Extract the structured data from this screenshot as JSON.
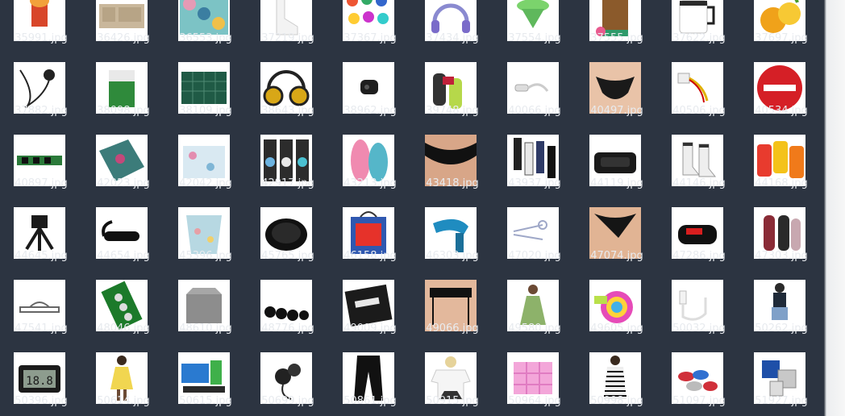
{
  "files": [
    {
      "name": "35991.jpg",
      "icon": "snack-pack-icon"
    },
    {
      "name": "36426.jpg",
      "icon": "fabric-organizer-icon"
    },
    {
      "name": "36553.jpg",
      "icon": "patterned-tins-icon"
    },
    {
      "name": "37219.jpg",
      "icon": "white-socks-icon"
    },
    {
      "name": "37367.jpg",
      "icon": "color-pigments-icon"
    },
    {
      "name": "37434.jpg",
      "icon": "headphones-icon"
    },
    {
      "name": "37554.jpg",
      "icon": "green-funnel-icon"
    },
    {
      "name": "37555.jpg",
      "icon": "bamboo-mat-icon"
    },
    {
      "name": "37622.jpg",
      "icon": "mug-icon"
    },
    {
      "name": "37697.jpg",
      "icon": "citrus-icon"
    },
    {
      "name": "37882.jpg",
      "icon": "lavalier-mic-icon"
    },
    {
      "name": "38098.jpg",
      "icon": "battery-icon"
    },
    {
      "name": "38109.jpg",
      "icon": "cutting-mat-icon"
    },
    {
      "name": "38643.jpg",
      "icon": "gold-headphones-icon"
    },
    {
      "name": "38962.jpg",
      "icon": "earbuds-case-icon"
    },
    {
      "name": "39748.jpg",
      "icon": "fitness-bands-icon"
    },
    {
      "name": "40066.jpg",
      "icon": "adapter-cable-icon"
    },
    {
      "name": "40497.jpg",
      "icon": "lace-panties-icon"
    },
    {
      "name": "40506.jpg",
      "icon": "power-cable-icon"
    },
    {
      "name": "40534.jpg",
      "icon": "no-entry-sign-icon"
    },
    {
      "name": "40897.jpg",
      "icon": "memory-module-icon"
    },
    {
      "name": "42023.jpg",
      "icon": "scarf-icon"
    },
    {
      "name": "42042.jpg",
      "icon": "floral-bag-icon"
    },
    {
      "name": "42917.jpg",
      "icon": "cable-packs-icon"
    },
    {
      "name": "43213.jpg",
      "icon": "flip-flops-icon"
    },
    {
      "name": "43418.jpg",
      "icon": "black-lingerie-icon"
    },
    {
      "name": "43937.jpg",
      "icon": "striped-socks-icon"
    },
    {
      "name": "44119.jpg",
      "icon": "vr-headset-icon"
    },
    {
      "name": "44146.jpg",
      "icon": "ankle-socks-icon"
    },
    {
      "name": "44168.jpg",
      "icon": "phone-cases-icon"
    },
    {
      "name": "44645.jpg",
      "icon": "tripod-icon"
    },
    {
      "name": "44654.jpg",
      "icon": "phone-holder-icon"
    },
    {
      "name": "45396.jpg",
      "icon": "laundry-basket-icon"
    },
    {
      "name": "45765.jpg",
      "icon": "wireless-charger-icon"
    },
    {
      "name": "46158.jpg",
      "icon": "gift-bag-icon"
    },
    {
      "name": "46303.jpg",
      "icon": "guitar-capo-icon"
    },
    {
      "name": "47020.jpg",
      "icon": "hair-pins-icon"
    },
    {
      "name": "47074.jpg",
      "icon": "thong-icon"
    },
    {
      "name": "47286.jpg",
      "icon": "trash-bags-icon"
    },
    {
      "name": "47303.jpg",
      "icon": "power-banks-icon"
    },
    {
      "name": "47541.jpg",
      "icon": "wire-frame-icon"
    },
    {
      "name": "48046.jpg",
      "icon": "coin-batteries-icon"
    },
    {
      "name": "48610.jpg",
      "icon": "storage-box-icon"
    },
    {
      "name": "48776.jpg",
      "icon": "black-beads-icon"
    },
    {
      "name": "49009.jpg",
      "icon": "boxed-product-icon"
    },
    {
      "name": "49066.jpg",
      "icon": "garter-set-icon"
    },
    {
      "name": "49580.jpg",
      "icon": "green-dress-icon"
    },
    {
      "name": "49605.jpg",
      "icon": "colorful-sponges-icon"
    },
    {
      "name": "50032.jpg",
      "icon": "usb-cable-icon"
    },
    {
      "name": "50262.jpg",
      "icon": "denim-outfit-icon"
    },
    {
      "name": "50396.jpg",
      "icon": "digital-thermometer-icon"
    },
    {
      "name": "50614.jpg",
      "icon": "yellow-dress-icon"
    },
    {
      "name": "50615.jpg",
      "icon": "device-set-icon"
    },
    {
      "name": "50699.jpg",
      "icon": "earphones-icon"
    },
    {
      "name": "50861.jpg",
      "icon": "black-trousers-icon"
    },
    {
      "name": "50915.jpg",
      "icon": "white-tshirt-icon"
    },
    {
      "name": "50964.jpg",
      "icon": "pink-organizer-icon"
    },
    {
      "name": "50998.jpg",
      "icon": "striped-dress-icon"
    },
    {
      "name": "51097.jpg",
      "icon": "bottle-caps-icon"
    },
    {
      "name": "51927.jpg",
      "icon": "otg-adapters-icon"
    }
  ],
  "colors": {
    "background": "#2c3441",
    "label": "#e8ebef",
    "thumb_bg": "#ffffff"
  }
}
